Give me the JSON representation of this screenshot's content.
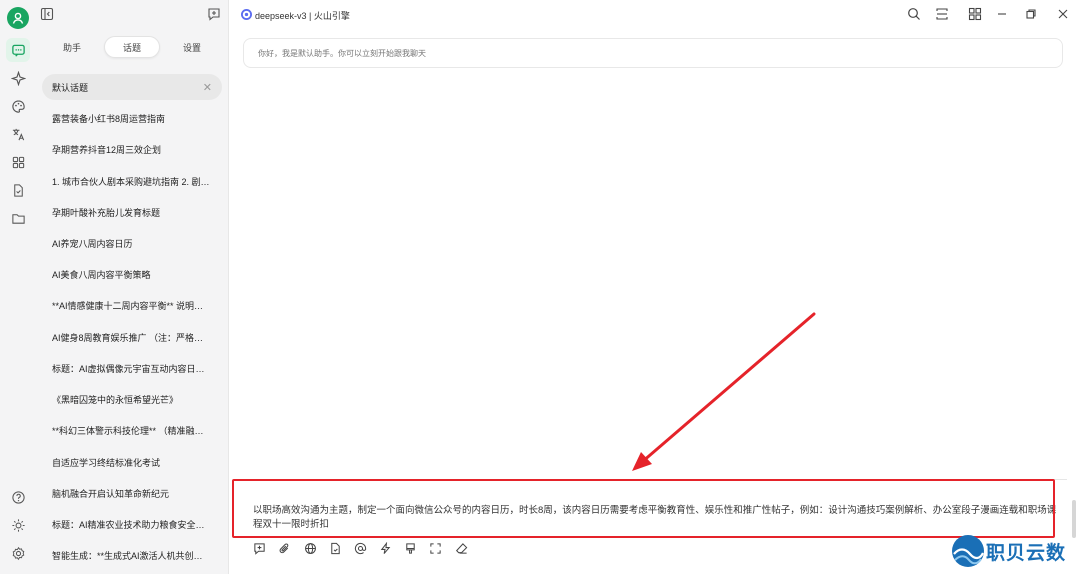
{
  "header": {
    "title": "deepseek-v3 | 火山引擎"
  },
  "tabs": [
    {
      "label": "助手"
    },
    {
      "label": "话题"
    },
    {
      "label": "设置"
    }
  ],
  "topics": [
    {
      "label": "默认话题"
    },
    {
      "label": "露营装备小红书8周运营指南"
    },
    {
      "label": "孕期营养抖音12周三效企划"
    },
    {
      "label": "1. 城市合伙人剧本采购避坑指南 2. 剧…"
    },
    {
      "label": "孕期叶酸补充胎儿发育标题"
    },
    {
      "label": "AI养宠八周内容日历"
    },
    {
      "label": "AI美食八周内容平衡策略"
    },
    {
      "label": "**AI情感健康十二周内容平衡** 说明…"
    },
    {
      "label": "AI健身8周教育娱乐推广 （注：严格…"
    },
    {
      "label": "标题：AI虚拟偶像元宇宙互动内容日…"
    },
    {
      "label": "《黑暗囚笼中的永恒希望光芒》"
    },
    {
      "label": "**科幻三体警示科技伦理** （精准融…"
    },
    {
      "label": "自适应学习终结标准化考试"
    },
    {
      "label": "脑机融合开启认知革命新纪元"
    },
    {
      "label": "标题：AI精准农业技术助力粮食安全…"
    },
    {
      "label": "智能生成：**生成式AI激活人机共创…"
    }
  ],
  "chat": {
    "welcome": "你好，我是默认助手。你可以立刻开始跟我聊天",
    "input_value": "以职场高效沟通为主题，制定一个面向微信公众号的内容日历，时长8周，该内容日历需要考虑平衡教育性、娱乐性和推广性帖子，例如：设计沟通技巧案例解析、办公室段子漫画连载和职场课程双十一限时折扣"
  },
  "watermark": {
    "text": "职贝云数"
  },
  "colors": {
    "accent": "#19a561",
    "highlight": "#e5232a",
    "watermark": "#1a6fb6"
  }
}
